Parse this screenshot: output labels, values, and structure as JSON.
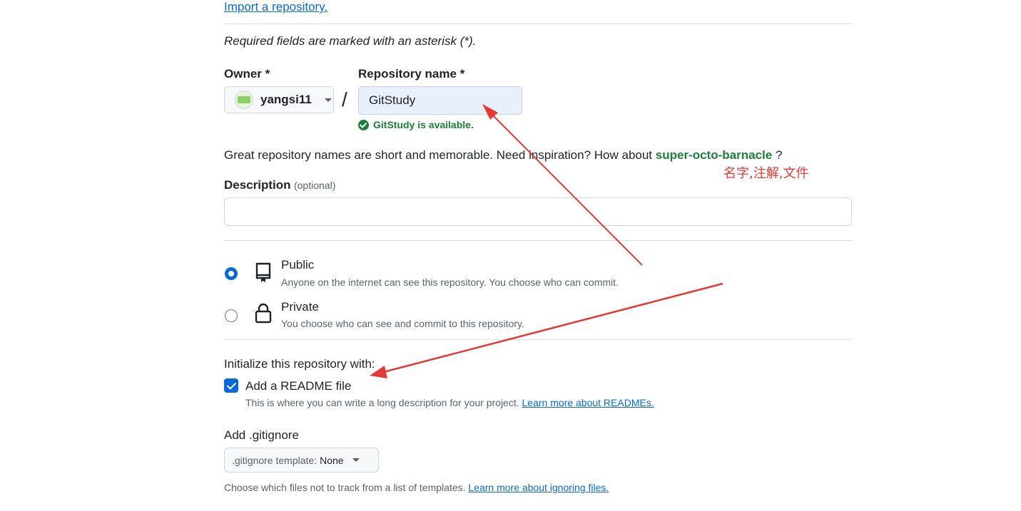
{
  "import_link": "Import a repository.",
  "required_note": "Required fields are marked with an asterisk (*).",
  "owner": {
    "label": "Owner *",
    "selected": "yangsi11"
  },
  "slash": "/",
  "repo_name": {
    "label": "Repository name *",
    "value": "GitStudy",
    "availability": "GitStudy is available."
  },
  "suggestion": {
    "prefix": "Great repository names are short and memorable. Need inspiration? How about",
    "name": "super-octo-barnacle",
    "suffix": "?"
  },
  "annotation_text": "名字,注解,文件",
  "description": {
    "label": "Description",
    "optional": "(optional)",
    "value": ""
  },
  "visibility": [
    {
      "title": "Public",
      "subtitle": "Anyone on the internet can see this repository. You choose who can commit.",
      "selected": true
    },
    {
      "title": "Private",
      "subtitle": "You choose who can see and commit to this repository.",
      "selected": false
    }
  ],
  "init": {
    "heading": "Initialize this repository with:",
    "readme_label": "Add a README file",
    "readme_checked": true,
    "readme_help": "This is where you can write a long description for your project.",
    "readme_link": "Learn more about READMEs."
  },
  "gitignore": {
    "heading": "Add .gitignore",
    "template_label": ".gitignore template:",
    "template_value": "None",
    "help": "Choose which files not to track from a list of templates.",
    "help_link": "Learn more about ignoring files."
  },
  "colors": {
    "accent": "#0969da",
    "success": "#1a7f37",
    "annotation": "#e53935"
  }
}
